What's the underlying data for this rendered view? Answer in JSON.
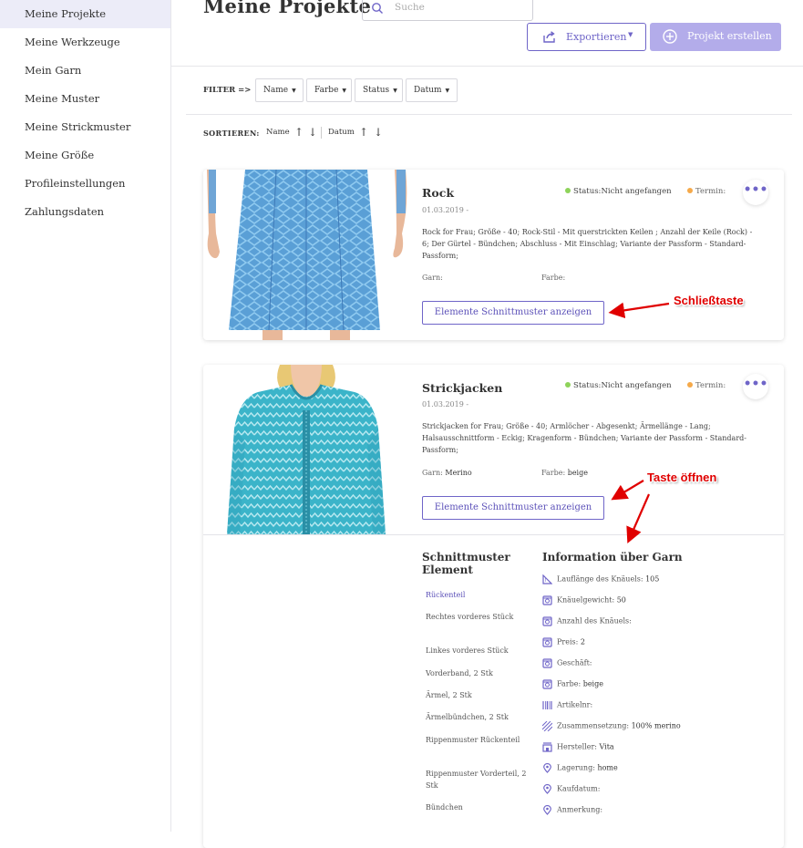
{
  "sidebar": {
    "items": [
      {
        "label": "Meine Projekte"
      },
      {
        "label": "Meine Werkzeuge"
      },
      {
        "label": "Mein Garn"
      },
      {
        "label": "Meine Muster"
      },
      {
        "label": "Meine Strickmuster"
      },
      {
        "label": "Meine Größe"
      },
      {
        "label": "Profileinstellungen"
      },
      {
        "label": "Zahlungsdaten"
      }
    ]
  },
  "header": {
    "title": "Meine Projekte",
    "search_placeholder": "Suche",
    "export_label": "Exportieren",
    "create_label": "Projekt erstellen"
  },
  "filter": {
    "label": "FILTER =>",
    "buttons": [
      "Name",
      "Farbe",
      "Status",
      "Datum"
    ]
  },
  "sort": {
    "label": "SORTIEREN:",
    "items": [
      "Name",
      "Datum"
    ]
  },
  "projects": [
    {
      "title": "Rock",
      "date": "01.03.2019 -",
      "status_label": "Status:",
      "status_value": "Nicht angefangen",
      "termin_label": "Termin:",
      "description": "Rock for Frau; Größe - 40; Rock-Stil - Mit querstrickten Keilen ; Anzahl der Keile (Rock) - 6; Der Gürtel - Bündchen; Abschluss - Mit Einschlag; Variante der Passform - Standard-Passform;",
      "garn_label": "Garn:",
      "garn_value": "",
      "farbe_label": "Farbe:",
      "farbe_value": "",
      "button_label": "Elemente Schnittmuster anzeigen",
      "annotation": "Schließtaste"
    },
    {
      "title": "Strickjacken",
      "date": "01.03.2019 -",
      "status_label": "Status:",
      "status_value": "Nicht angefangen",
      "termin_label": "Termin:",
      "description": "Strickjacken for Frau; Größe - 40; Armlöcher - Abgesenkt; Ärmellänge - Lang; Halsausschnittform - Eckig; Kragenform - Bündchen; Variante der Passform - Standard-Passform;",
      "garn_label": "Garn:",
      "garn_value": "Merino",
      "farbe_label": "Farbe:",
      "farbe_value": "beige",
      "button_label": "Elemente Schnittmuster anzeigen",
      "annotation": "Taste öffnen",
      "pattern_title": "Schnittmuster Element",
      "pattern_items": [
        "Rückenteil",
        "Rechtes vorderes Stück",
        "Linkes vorderes Stück",
        "Vorderband, 2 Stk",
        "Ärmel, 2 Stk",
        "Ärmelbündchen, 2 Stk",
        "Rippenmuster Rückenteil",
        "Rippenmuster Vorderteil, 2 Stk",
        "Bündchen"
      ],
      "yarn_title": "Information über Garn",
      "yarn_info": [
        {
          "label": "Lauflänge des Knäuels:",
          "value": "105",
          "icon": "ruler-icon"
        },
        {
          "label": "Knäuelgewicht:",
          "value": "50",
          "icon": "scale-icon"
        },
        {
          "label": "Anzahl des Knäuels:",
          "value": "",
          "icon": "scale-icon"
        },
        {
          "label": "Preis:",
          "value": "2",
          "icon": "scale-icon"
        },
        {
          "label": "Geschäft:",
          "value": "",
          "icon": "scale-icon"
        },
        {
          "label": "Farbe:",
          "value": "beige",
          "icon": "scale-icon"
        },
        {
          "label": "Artikelnr:",
          "value": "",
          "icon": "barcode-icon"
        },
        {
          "label": "Zusammensetzung:",
          "value": "100% merino",
          "icon": "texture-icon"
        },
        {
          "label": "Hersteller:",
          "value": "Vita",
          "icon": "factory-icon"
        },
        {
          "label": "Lagerung:",
          "value": "home",
          "icon": "location-icon"
        },
        {
          "label": "Kaufdatum:",
          "value": "",
          "icon": "location-icon"
        },
        {
          "label": "Anmerkung:",
          "value": "",
          "icon": "location-icon"
        }
      ]
    }
  ],
  "colors": {
    "accent": "#6f65c8",
    "status_dot": "#8ed35a",
    "termin_dot": "#f5a94a",
    "annotation": "#e00000"
  }
}
